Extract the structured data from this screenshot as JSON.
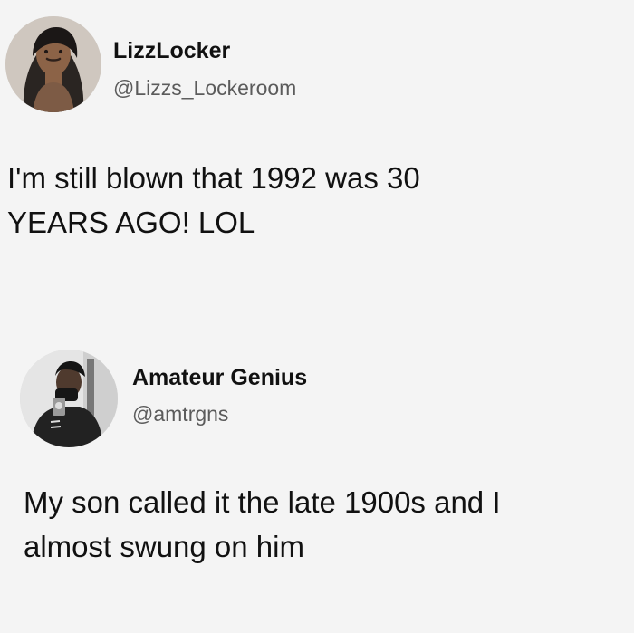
{
  "tweets": [
    {
      "display_name": "LizzLocker",
      "handle": "@Lizzs_Lockeroom",
      "text_lines": [
        "I'm still blown that 1992 was 30",
        "YEARS AGO! LOL"
      ],
      "avatar_icon": "cartoon-woman-avatar-icon"
    },
    {
      "display_name": "Amateur Genius",
      "handle": "@amtrgns",
      "text_lines": [
        "My son called it the late 1900s and I",
        "almost swung on him"
      ],
      "avatar_icon": "mirror-selfie-avatar-icon"
    }
  ],
  "colors": {
    "background": "#f4f4f4",
    "text": "#111111",
    "handle": "#5b5b5b"
  }
}
